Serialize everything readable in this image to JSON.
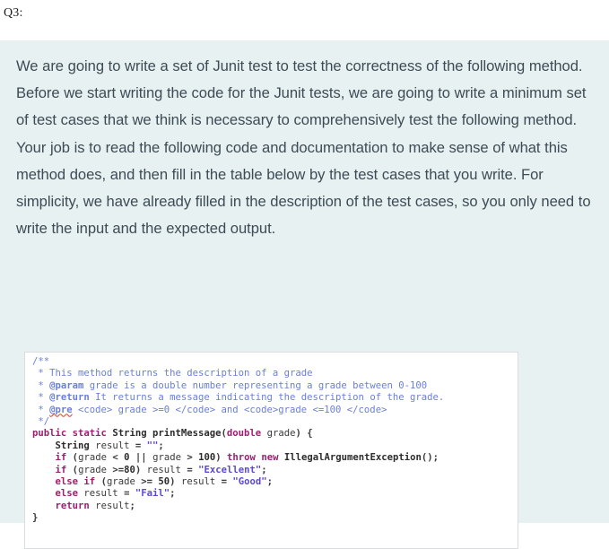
{
  "question": {
    "label": "Q3:"
  },
  "prompt": {
    "text": "We are going to write a set of Junit test to test the correctness of the following method. Before we start writing the code for the Junit tests, we are going to write a minimum set of test cases that we think is necessary to comprehensively test the following method. Your job is to read the following code and documentation to make sense of what this method does, and then fill in the table below by the test cases that you write. For simplicity, we have already filled in the description of the test cases, so you only need to write the input and the expected output."
  },
  "code": {
    "language": "java",
    "lines": [
      "/**",
      " * This method returns the description of a grade",
      " * @param grade is a double number representing a grade between 0-100",
      " * @return It returns a message indicating the description of the grade.",
      " * @pre <code> grade >=0 </code> and <code>grade <=100 </code>",
      " */",
      "public static String printMessage(double grade) {",
      "    String result = \"\";",
      "    if (grade < 0 || grade > 100) throw new IllegalArgumentException();",
      "    if (grade >=80) result = \"Excellent\";",
      "    else if (grade >= 50) result = \"Good\";",
      "    else result = \"Fail\";",
      "    return result;",
      "}"
    ],
    "method_name": "printMessage",
    "return_type": "String",
    "parameter": "double grade",
    "strings": [
      "\"\"",
      "\"Excellent\"",
      "\"Good\"",
      "\"Fail\""
    ],
    "thresholds": [
      0,
      100,
      80,
      50
    ],
    "exception": "IllegalArgumentException",
    "javadoc_tags": [
      "@param",
      "@return",
      "@pre"
    ],
    "misspelled_token": "@pre"
  },
  "colors": {
    "panel_background": "#e8f1f2",
    "page_background": "#ffffff",
    "prompt_text": "#3c4b55",
    "code_background": "#ffffff",
    "code_border": "#d9dde0",
    "comment": "#6a7fd8",
    "keyword": "#9b1f6e",
    "string": "#5b49d6",
    "identifier": "#2b2b2b",
    "spellcheck_underline": "#e0503c"
  }
}
